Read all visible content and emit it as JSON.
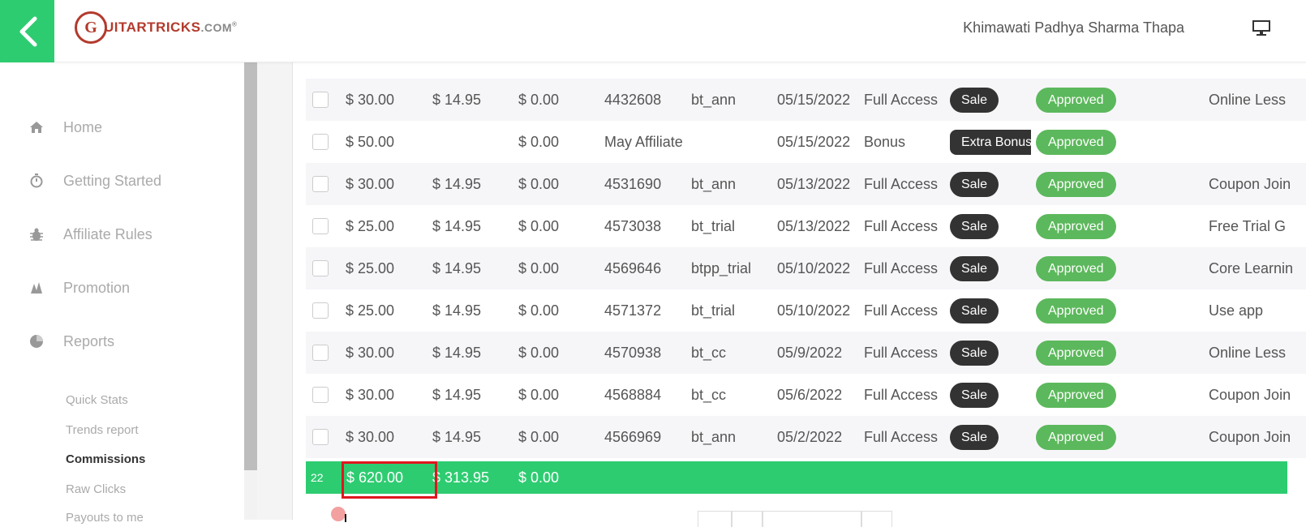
{
  "header": {
    "logo": {
      "letter": "G",
      "text": "UITARTRICKS",
      "dotcom": ".COM",
      "mark": "®"
    },
    "username": "Khimawati Padhya Sharma Thapa"
  },
  "sidebar": {
    "items": [
      {
        "label": "Home",
        "icon": "home-icon"
      },
      {
        "label": "Getting Started",
        "icon": "stopwatch-icon"
      },
      {
        "label": "Affiliate Rules",
        "icon": "bug-icon"
      },
      {
        "label": "Promotion",
        "icon": "promotion-icon"
      },
      {
        "label": "Reports",
        "icon": "pie-chart-icon"
      }
    ],
    "subitems": [
      {
        "label": "Quick Stats"
      },
      {
        "label": "Trends report"
      },
      {
        "label": "Commissions",
        "active": true
      },
      {
        "label": "Raw Clicks"
      },
      {
        "label": "Payouts to me"
      }
    ]
  },
  "table": {
    "rows": [
      {
        "commission": "$ 30.00",
        "sale": "$ 14.95",
        "refund": "$ 0.00",
        "id": "4432608",
        "code": "bt_ann",
        "date": "05/15/2022",
        "product": "Full Access",
        "type": "Sale",
        "status": "Approved",
        "notes": "Online Less"
      },
      {
        "commission": "$ 50.00",
        "sale": "",
        "refund": "$ 0.00",
        "id": "May Affiliate",
        "code": "",
        "date": "05/15/2022",
        "product": "Bonus",
        "type": "Extra Bonus",
        "status": "Approved",
        "notes": ""
      },
      {
        "commission": "$ 30.00",
        "sale": "$ 14.95",
        "refund": "$ 0.00",
        "id": "4531690",
        "code": "bt_ann",
        "date": "05/13/2022",
        "product": "Full Access",
        "type": "Sale",
        "status": "Approved",
        "notes": "Coupon Join"
      },
      {
        "commission": "$ 25.00",
        "sale": "$ 14.95",
        "refund": "$ 0.00",
        "id": "4573038",
        "code": "bt_trial",
        "date": "05/13/2022",
        "product": "Full Access",
        "type": "Sale",
        "status": "Approved",
        "notes": "Free Trial G"
      },
      {
        "commission": "$ 25.00",
        "sale": "$ 14.95",
        "refund": "$ 0.00",
        "id": "4569646",
        "code": "btpp_trial",
        "date": "05/10/2022",
        "product": "Full Access",
        "type": "Sale",
        "status": "Approved",
        "notes": "Core Learnin"
      },
      {
        "commission": "$ 25.00",
        "sale": "$ 14.95",
        "refund": "$ 0.00",
        "id": "4571372",
        "code": "bt_trial",
        "date": "05/10/2022",
        "product": "Full Access",
        "type": "Sale",
        "status": "Approved",
        "notes": "Use app"
      },
      {
        "commission": "$ 30.00",
        "sale": "$ 14.95",
        "refund": "$ 0.00",
        "id": "4570938",
        "code": "bt_cc",
        "date": "05/9/2022",
        "product": "Full Access",
        "type": "Sale",
        "status": "Approved",
        "notes": "Online Less"
      },
      {
        "commission": "$ 30.00",
        "sale": "$ 14.95",
        "refund": "$ 0.00",
        "id": "4568884",
        "code": "bt_cc",
        "date": "05/6/2022",
        "product": "Full Access",
        "type": "Sale",
        "status": "Approved",
        "notes": "Coupon Join"
      },
      {
        "commission": "$ 30.00",
        "sale": "$ 14.95",
        "refund": "$ 0.00",
        "id": "4566969",
        "code": "bt_ann",
        "date": "05/2/2022",
        "product": "Full Access",
        "type": "Sale",
        "status": "Approved",
        "notes": "Coupon Join"
      }
    ],
    "totals": {
      "count": "22",
      "commission": "$ 620.00",
      "sale": "$ 313.95",
      "refund": "$ 0.00"
    }
  },
  "colors": {
    "brand_green": "#2ecc71",
    "approved_green": "#5cb85c",
    "sale_dark": "#333333",
    "highlight_red": "#e0161e"
  }
}
